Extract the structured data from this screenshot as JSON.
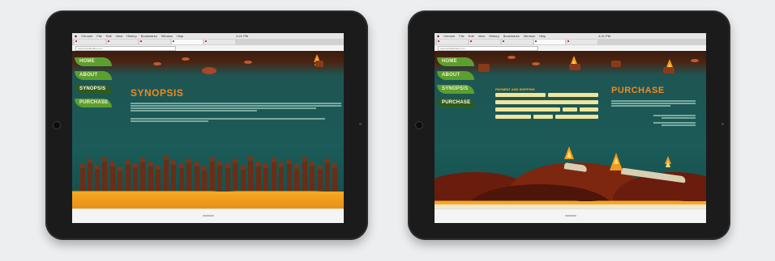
{
  "tablets": [
    {
      "id": "left",
      "browser": {
        "menu": [
          "Chrome",
          "File",
          "Edit",
          "View",
          "History",
          "Bookmarks",
          "Window",
          "Help"
        ],
        "clock": "4:21 PM",
        "url": "www.lordoftheflies.com"
      },
      "nav": [
        {
          "label": "HOME",
          "active": false
        },
        {
          "label": "ABOUT",
          "active": false
        },
        {
          "label": "SYNOPSIS",
          "active": true
        },
        {
          "label": "PURCHASE",
          "active": false
        }
      ],
      "page": {
        "heading": "SYNOPSIS"
      }
    },
    {
      "id": "right",
      "browser": {
        "menu": [
          "Chrome",
          "File",
          "Edit",
          "View",
          "History",
          "Bookmarks",
          "Window",
          "Help"
        ],
        "clock": "4:21 PM",
        "url": "www.lordoftheflies.com"
      },
      "nav": [
        {
          "label": "HOME",
          "active": false
        },
        {
          "label": "ABOUT",
          "active": false
        },
        {
          "label": "SYNOPSIS",
          "active": false
        },
        {
          "label": "PURCHASE",
          "active": true
        }
      ],
      "page": {
        "heading": "PURCHASE",
        "form_title": "PAYMENT AND SHIPPING"
      }
    }
  ],
  "colors": {
    "nav_leaf": "#5b9f2f",
    "nav_leaf_active": "#2f5b1a",
    "heading": "#f08a1e",
    "teal_bg": "#1b5b58",
    "sand": "#f6a822",
    "form_field": "#f0e59a"
  }
}
